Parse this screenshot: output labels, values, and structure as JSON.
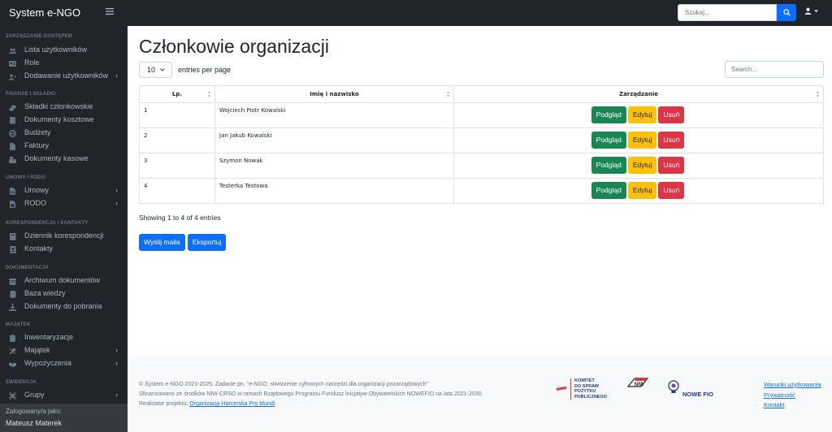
{
  "app": {
    "title": "System e-NGO",
    "search_placeholder": "Szukaj..."
  },
  "icons": {
    "menu": "hamburger-icon",
    "search": "search-icon",
    "user": "user-icon"
  },
  "colors": {
    "primary": "#0d6efd",
    "success": "#198754",
    "warning": "#ffc107",
    "danger": "#dc3545",
    "sidebar": "#212529"
  },
  "sidebar": {
    "sections": [
      {
        "title": "ZARZĄDZANIE DOSTĘPEM"
      },
      {
        "title": "FINANSE I SKŁADKI"
      },
      {
        "title": "UMOWY I RODO"
      },
      {
        "title": "KORESPONDENCJA I KONTAKTY"
      },
      {
        "title": "DOKUMENTACJA"
      },
      {
        "title": "MAJĄTEK"
      },
      {
        "title": "EWIDENCJA"
      }
    ],
    "items": [
      {
        "label": "Lista użytkowników",
        "icon": "users-icon"
      },
      {
        "label": "Role",
        "icon": "id-card-icon"
      },
      {
        "label": "Dodawanie użytkowników",
        "icon": "user-plus-icon"
      },
      {
        "label": "Składki członkowskie",
        "icon": "coins-icon"
      },
      {
        "label": "Dokumenty kosztowe",
        "icon": "receipt-icon"
      },
      {
        "label": "Budżety",
        "icon": "globe-icon"
      },
      {
        "label": "Faktury",
        "icon": "file-icon"
      },
      {
        "label": "Dokumenty kasowe",
        "icon": "cash-register-icon"
      },
      {
        "label": "Umowy",
        "icon": "file-contract-icon"
      },
      {
        "label": "RODO",
        "icon": "file-shield-icon"
      },
      {
        "label": "Dziennik korespondencji",
        "icon": "book-icon"
      },
      {
        "label": "Kontakty",
        "icon": "address-book-icon"
      },
      {
        "label": "Archiwum dokumentów",
        "icon": "archive-icon"
      },
      {
        "label": "Baza wiedzy",
        "icon": "database-icon"
      },
      {
        "label": "Dokumenty do pobrania",
        "icon": "download-icon"
      },
      {
        "label": "Inwentaryzacje",
        "icon": "clipboard-list-icon"
      },
      {
        "label": "Majątek",
        "icon": "tools-icon"
      },
      {
        "label": "Wypożyczenia",
        "icon": "handshake-icon"
      },
      {
        "label": "Grupy",
        "icon": "group-icon"
      }
    ],
    "footer_label": "Zalogowany/a jako:",
    "footer_user": "Mateusz Materek"
  },
  "main": {
    "title": "Członkowie organizacji",
    "length_value": "10",
    "length_label": "entries per page",
    "filter_placeholder": "Search...",
    "columns": [
      "Lp.",
      "Imię i nazwisko",
      "Zarządzanie"
    ],
    "rows": [
      {
        "lp": "1",
        "name": "Wojciech Piotr Kowalski"
      },
      {
        "lp": "2",
        "name": "Jan Jakub Kowalski"
      },
      {
        "lp": "3",
        "name": "Szymon Nowak"
      },
      {
        "lp": "4",
        "name": "Testerka Testowa"
      }
    ],
    "actions": {
      "view": "Podgląd",
      "edit": "Edytuj",
      "delete": "Usuń"
    },
    "info": "Showing 1 to 4 of 4 entries",
    "send_mail": "Wyślij maila",
    "export": "Eksportuj"
  },
  "footer": {
    "line1": "© System e-NGO 2023-2025. Zadanie pn. \"e-NGO: stworzenie cyfrowych narzędzi dla organizacji pozarządowych\"",
    "line2": "Sfinansowano ze środków NIW-CRSO w ramach Rządowego Programu Fundusz Inicjatyw Obywatelskich NOWEFIO na lata 2021-2030",
    "line3_prefix": "Realizator projektu:",
    "line3_link": "Organizacja Harcerska Pro Mundi",
    "links": [
      "Warunki użytkowania",
      "Prywatność",
      "Kontakt"
    ],
    "logo1": [
      "KOMITET",
      "DO SPRAW",
      "POŻYTKU",
      "PUBLICZNEGO"
    ],
    "logo2": "NIW",
    "logo3": "NOWE FIO"
  }
}
